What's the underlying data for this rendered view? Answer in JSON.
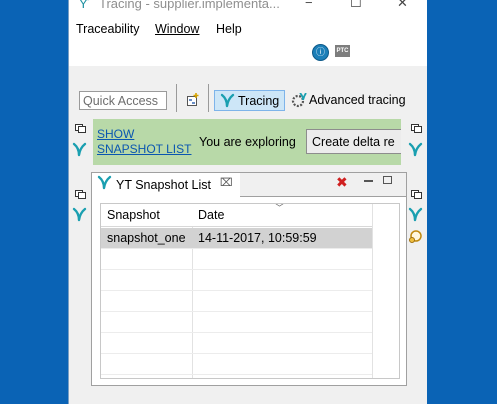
{
  "window": {
    "title": "Tracing - supplier.implementa...",
    "controls": {
      "minimize": "−",
      "maximize": "☐",
      "close": "✕"
    }
  },
  "menu": {
    "items": [
      {
        "label": "Traceability"
      },
      {
        "label": "Window"
      },
      {
        "label": "Help"
      }
    ]
  },
  "toolbar": {
    "ptc_label": "PTC"
  },
  "quick_access": {
    "placeholder": "Quick Access"
  },
  "perspectives": {
    "tracing_label": "Tracing",
    "advanced_label": "Advanced tracing"
  },
  "banner": {
    "show_link_line1": "SHOW",
    "show_link_line2": "SNAPSHOT LIST",
    "explore_text": "You are exploring",
    "delta_button": "Create delta re"
  },
  "view": {
    "tab_label": "YT Snapshot List",
    "columns": [
      "Snapshot",
      "Date"
    ],
    "rows": [
      {
        "snapshot": "snapshot_one",
        "date": "14-11-2017, 10:59:59",
        "selected": true
      }
    ]
  },
  "colors": {
    "desktop": "#0a63b5",
    "banner": "#b8d9a8",
    "link": "#0a56b0",
    "selected_row": "#d2d2d2",
    "accent_icon": "#1a9fb0"
  }
}
